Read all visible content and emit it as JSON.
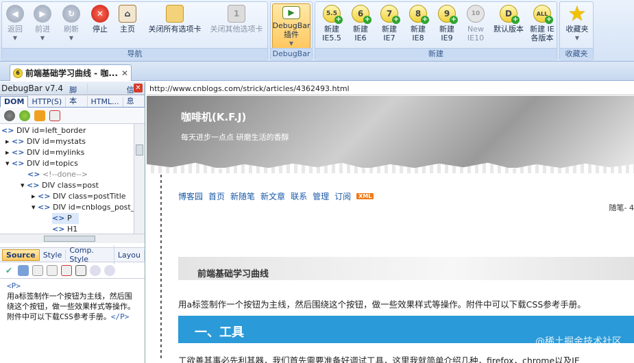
{
  "ribbon": {
    "nav_group": {
      "label": "导航",
      "buttons": [
        {
          "label": "返回",
          "icon": "back-icon"
        },
        {
          "label": "前进",
          "icon": "forward-icon"
        },
        {
          "label": "刷新",
          "icon": "refresh-icon"
        },
        {
          "label": "停止",
          "icon": "stop-icon"
        },
        {
          "label": "主页",
          "icon": "home-icon"
        },
        {
          "label": "关闭所有选项卡",
          "icon": "close-all-tabs-icon"
        },
        {
          "label": "关闭其他选项卡",
          "icon": "close-other-tabs-icon"
        }
      ]
    },
    "debugbar_group": {
      "label": "DebugBar",
      "button_line1": "DebugBar",
      "button_line2": "插件"
    },
    "new_group": {
      "label": "新建",
      "buttons": [
        {
          "line1": "新建",
          "line2": "IE5.5",
          "glyph": "5.5"
        },
        {
          "line1": "新建",
          "line2": "IE6",
          "glyph": "6"
        },
        {
          "line1": "新建",
          "line2": "IE7",
          "glyph": "7"
        },
        {
          "line1": "新建",
          "line2": "IE8",
          "glyph": "8"
        },
        {
          "line1": "新建",
          "line2": "IE9",
          "glyph": "9"
        },
        {
          "line1": "New",
          "line2": "IE10",
          "glyph": "10"
        },
        {
          "line1": "默认版本",
          "line2": "",
          "glyph": "D"
        },
        {
          "line1": "新建 IE",
          "line2": "各版本",
          "glyph": "ALL"
        }
      ]
    },
    "fav_group": {
      "label": "收藏夹",
      "button": "收藏夹"
    }
  },
  "tab": {
    "title": "前端基础学习曲线 - 咖...",
    "close": "✕"
  },
  "debugbar": {
    "title": "DebugBar v7.4",
    "tabs": [
      "DOM",
      "HTTP(S)",
      "脚本",
      "HTML...",
      "信息"
    ],
    "tree": [
      {
        "indent": 0,
        "text": "DIV id=left_border"
      },
      {
        "indent": 1,
        "text": "DIV id=mystats"
      },
      {
        "indent": 1,
        "text": "DIV id=mylinks"
      },
      {
        "indent": 1,
        "text": "DIV id=topics"
      },
      {
        "indent": 2,
        "text": "<!--done-->"
      },
      {
        "indent": 2,
        "text": "DIV class=post"
      },
      {
        "indent": 3,
        "text": "DIV class=postTitle"
      },
      {
        "indent": 3,
        "text": "DIV id=cnblogs_post_b"
      },
      {
        "indent": 4,
        "text": "P"
      },
      {
        "indent": 4,
        "text": "H1"
      }
    ],
    "source_tabs": [
      "Source",
      "Style",
      "Comp. Style",
      "Layou"
    ],
    "source": {
      "open_tag": "<P>",
      "text": "用a标签制作一个按钮为主线，然后围绕这个按钮，做一些效果样式等操作。附件中可以下载CSS参考手册。",
      "close_tag": "</P>"
    }
  },
  "address": "http://www.cnblogs.com/strick/articles/4362493.html",
  "page": {
    "site_title": "咖啡机(K.F.J)",
    "site_subtitle": "每天进步一点点  研磨生活的香醇",
    "nav": [
      "博客园",
      "首页",
      "新随笔",
      "新文章",
      "联系",
      "管理",
      "订阅"
    ],
    "xml_badge": "XML",
    "note": "随笔- 4",
    "post_title": "前端基础学习曲线",
    "intro": "用a标签制作一个按钮为主线，然后围绕这个按钮，做一些效果样式等操作。附件中可以下载CSS参考手册。",
    "h2": "一、工具",
    "para": "工欲善其事必先利其器，我们首先需要准备好调试工具，这里我就简单介绍几种，firefox，chrome以及IE",
    "watermark": "@稀土掘金技术社区"
  }
}
